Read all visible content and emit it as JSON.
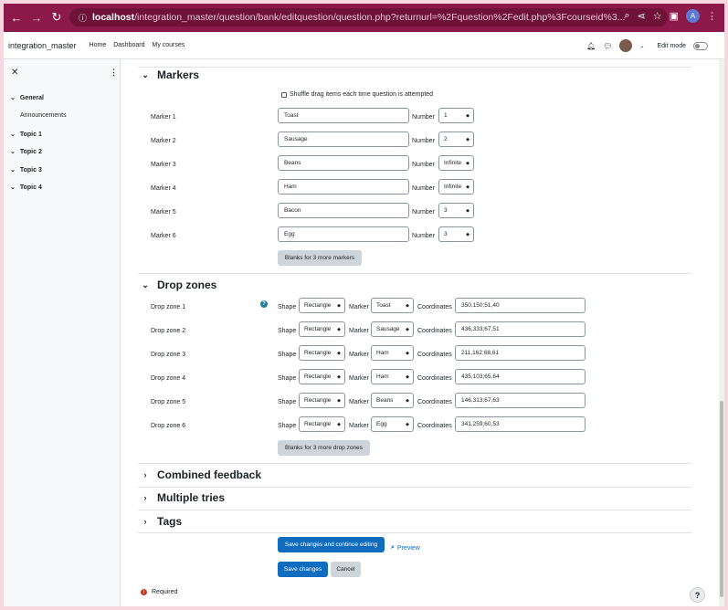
{
  "browser": {
    "url_host": "localhost",
    "url_path": "/integration_master/question/bank/editquestion/question.php?returnurl=%2Fquestion%2Fedit.php%3Fcourseid%3...",
    "profile_initial": "A"
  },
  "navbar": {
    "site_name": "integration_master",
    "links": [
      "Home",
      "Dashboard",
      "My courses"
    ],
    "edit_mode_label": "Edit mode"
  },
  "drawer": {
    "items": [
      {
        "label": "General",
        "bold": true,
        "chevron": true
      },
      {
        "label": "Announcements",
        "bold": false,
        "chevron": false
      },
      {
        "label": "Topic 1",
        "bold": true,
        "chevron": true
      },
      {
        "label": "Topic 2",
        "bold": true,
        "chevron": true
      },
      {
        "label": "Topic 3",
        "bold": true,
        "chevron": true
      },
      {
        "label": "Topic 4",
        "bold": true,
        "chevron": true
      }
    ]
  },
  "markers": {
    "heading": "Markers",
    "shuffle_label": "Shuffle drag items each time question is attempted",
    "number_label": "Number",
    "items": [
      {
        "label": "Marker 1",
        "text": "Toast",
        "number": "1"
      },
      {
        "label": "Marker 2",
        "text": "Sausage",
        "number": "2"
      },
      {
        "label": "Marker 3",
        "text": "Beans",
        "number": "Infinite"
      },
      {
        "label": "Marker 4",
        "text": "Ham",
        "number": "Infinite"
      },
      {
        "label": "Marker 5",
        "text": "Bacon",
        "number": "3"
      },
      {
        "label": "Marker 6",
        "text": "Egg",
        "number": "3"
      }
    ],
    "blanks_button": "Blanks for 3 more markers"
  },
  "dropzones": {
    "heading": "Drop zones",
    "shape_label": "Shape",
    "marker_label": "Marker",
    "coords_label": "Coordinates",
    "items": [
      {
        "label": "Drop zone 1",
        "shape": "Rectangle",
        "marker": "Toast",
        "coords": "350,150;51,40"
      },
      {
        "label": "Drop zone 2",
        "shape": "Rectangle",
        "marker": "Sausage",
        "coords": "436,333;67,51"
      },
      {
        "label": "Drop zone 3",
        "shape": "Rectangle",
        "marker": "Ham",
        "coords": "211,162;68,61"
      },
      {
        "label": "Drop zone 4",
        "shape": "Rectangle",
        "marker": "Ham",
        "coords": "435,103;65,64"
      },
      {
        "label": "Drop zone 5",
        "shape": "Rectangle",
        "marker": "Beans",
        "coords": "146,313;67,63"
      },
      {
        "label": "Drop zone 6",
        "shape": "Rectangle",
        "marker": "Egg",
        "coords": "341,259;60,53"
      }
    ],
    "blanks_button": "Blanks for 3 more drop zones"
  },
  "collapsed_sections": [
    "Combined feedback",
    "Multiple tries",
    "Tags"
  ],
  "actions": {
    "save_continue": "Save changes and continue editing",
    "preview": "Preview",
    "save": "Save changes",
    "cancel": "Cancel"
  },
  "required_label": "Required",
  "colors": {
    "chrome": "#8b1a4a",
    "primary": "#0f6cbf",
    "help": "#1f7e9a",
    "required": "#c0392b"
  }
}
